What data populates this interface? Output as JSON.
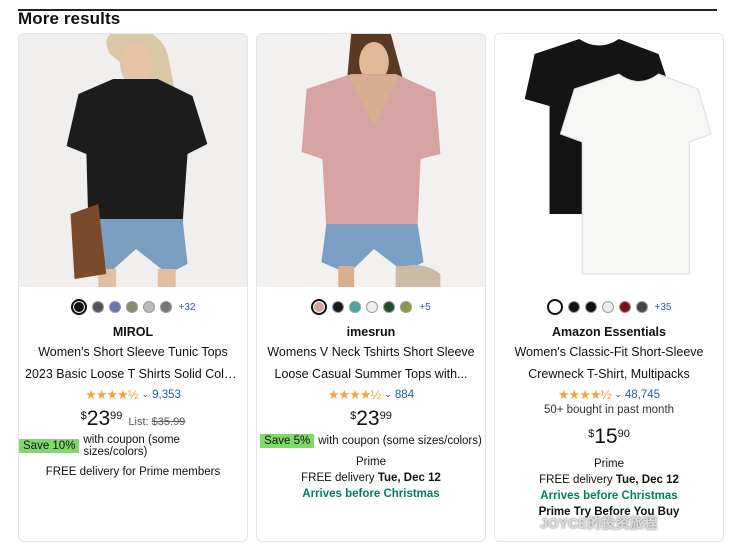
{
  "section": {
    "title": "More results"
  },
  "products": [
    {
      "brand": "MIROL",
      "title_line1": "Women's Short Sleeve Tunic Tops",
      "title_line2": "2023 Basic Loose T Shirts Solid Color...",
      "stars": "★★★★½",
      "rating_count": "9,353",
      "price_currency": "$",
      "price_whole": "23",
      "price_fraction": "99",
      "list_label": "List:",
      "list_price": "$35.99",
      "coupon_badge": "Save 10%",
      "coupon_text": "with coupon (some sizes/colors)",
      "delivery": "FREE delivery for Prime members",
      "swatch_more": "+32",
      "swatches": [
        "#111111",
        "#555555",
        "#6a74b8",
        "#8a8f6a",
        "#bbbbbb",
        "#777777"
      ]
    },
    {
      "brand": "imesrun",
      "title_line1": "Womens V Neck Tshirts Short Sleeve",
      "title_line2": "Loose Casual Summer Tops with...",
      "stars": "★★★★½",
      "rating_count": "884",
      "price_currency": "$",
      "price_whole": "23",
      "price_fraction": "99",
      "coupon_badge": "Save 5%",
      "coupon_text": "with coupon (some sizes/colors)",
      "prime": "Prime",
      "delivery_prefix": "FREE delivery",
      "delivery_date": "Tue, Dec 12",
      "arrives": "Arrives before Christmas",
      "swatch_more": "+5",
      "swatches": [
        "#d8a2a2",
        "#1a1a1a",
        "#4fa3a3",
        "#eeeeee",
        "#1e4d2b",
        "#8a9a4a"
      ]
    },
    {
      "brand": "Amazon Essentials",
      "title_line1": "Women's Classic-Fit Short-Sleeve",
      "title_line2": "Crewneck T-Shirt, Multipacks",
      "stars": "★★★★½",
      "rating_count": "48,745",
      "bought": "50+ bought in past month",
      "price_currency": "$",
      "price_whole": "15",
      "price_fraction": "90",
      "prime": "Prime",
      "delivery_prefix": "FREE delivery",
      "delivery_date": "Tue, Dec 12",
      "arrives": "Arrives before Christmas",
      "prime_try": "Prime Try Before You Buy",
      "swatch_more": "+35",
      "swatches": [
        "#ffffff",
        "#111111",
        "#111111",
        "#eeeeee",
        "#7a1020",
        "#444444"
      ]
    }
  ],
  "colors": {
    "star": "#f0a43a",
    "link": "#2162a1",
    "green": "#067d62",
    "coupon": "#7fda69"
  },
  "watermark": "JOYCE的投资旅程"
}
